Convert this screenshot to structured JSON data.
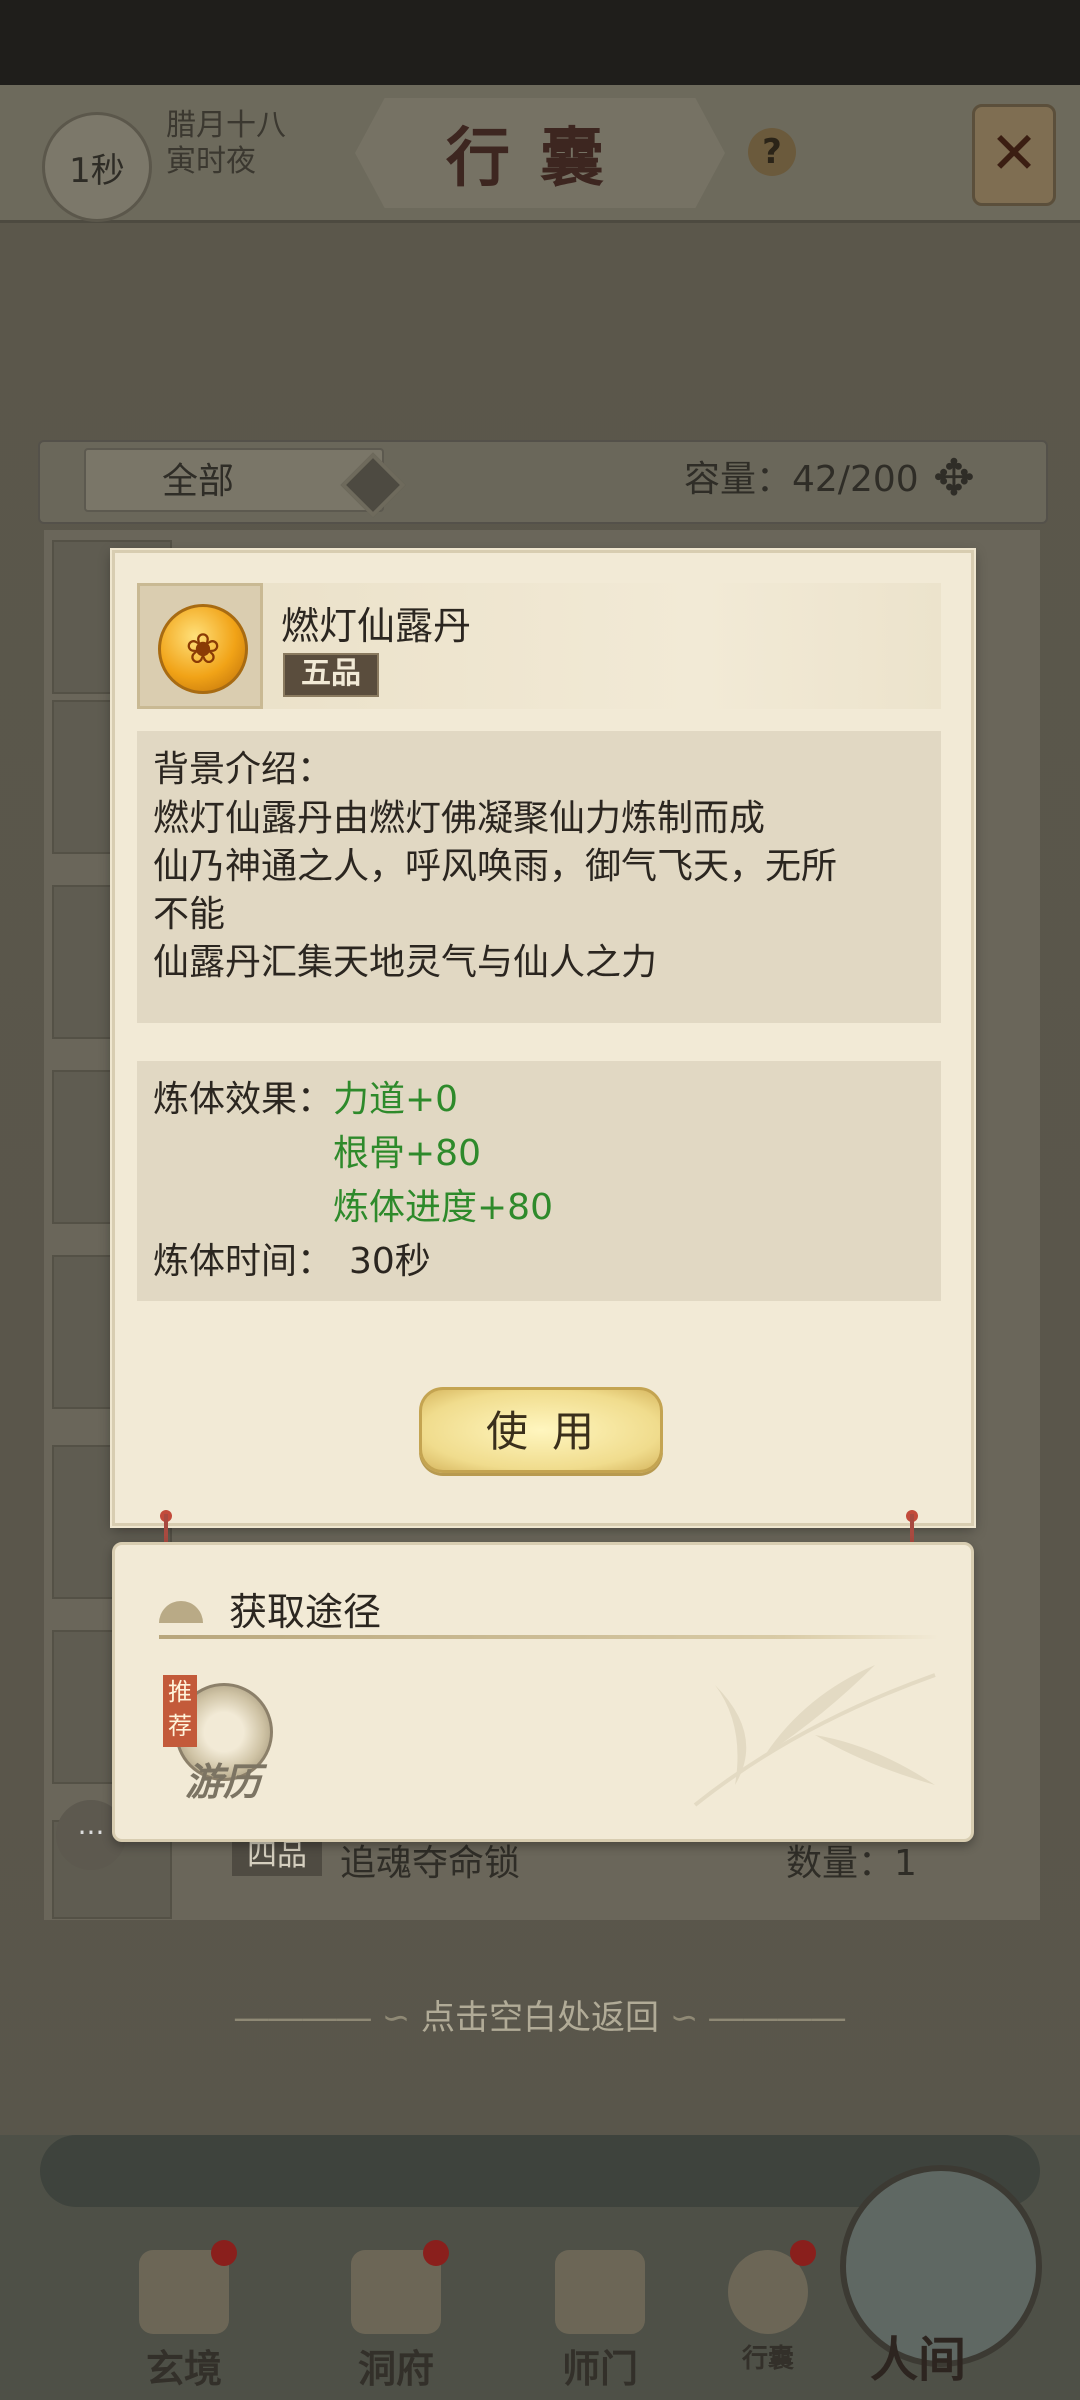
{
  "header": {
    "timer": "1秒",
    "date_line1": "腊月十八",
    "date_line2": "寅时夜",
    "title": "行囊",
    "help_glyph": "?",
    "close_glyph": "✕"
  },
  "filter": {
    "selected": "全部",
    "capacity": "容量：42/200"
  },
  "background_list": {
    "visible_row": {
      "grade": "四品",
      "name": "追魂夺命锁",
      "qty": "数量：1"
    }
  },
  "item_popup": {
    "name": "燃灯仙露丹",
    "grade": "五品",
    "icon": "lotus-pill-icon",
    "desc_title": "背景介绍：",
    "desc_lines": [
      "燃灯仙露丹由燃灯佛凝聚仙力炼制而成",
      "仙乃神通之人，呼风唤雨，御气飞天，无所",
      "不能",
      "仙露丹汇集天地灵气与仙人之力"
    ],
    "effect_label": "炼体效果：",
    "effects": [
      "力道+0",
      "根骨+80",
      "炼体进度+80"
    ],
    "time_label": "炼体时间：",
    "time_value": "30秒",
    "use_button": "使用"
  },
  "source_panel": {
    "title": "获取途径",
    "route_tag": "推荐",
    "route_label": "游历"
  },
  "back_hint": "点击空白处返回",
  "bottom_nav": {
    "items": [
      "玄境",
      "洞府",
      "师门",
      "行囊"
    ],
    "main": "人间"
  },
  "colors": {
    "effect_green": "#2e8a2b",
    "popup_bg": "#f2ead6",
    "badge_red": "#8a1f1c"
  }
}
